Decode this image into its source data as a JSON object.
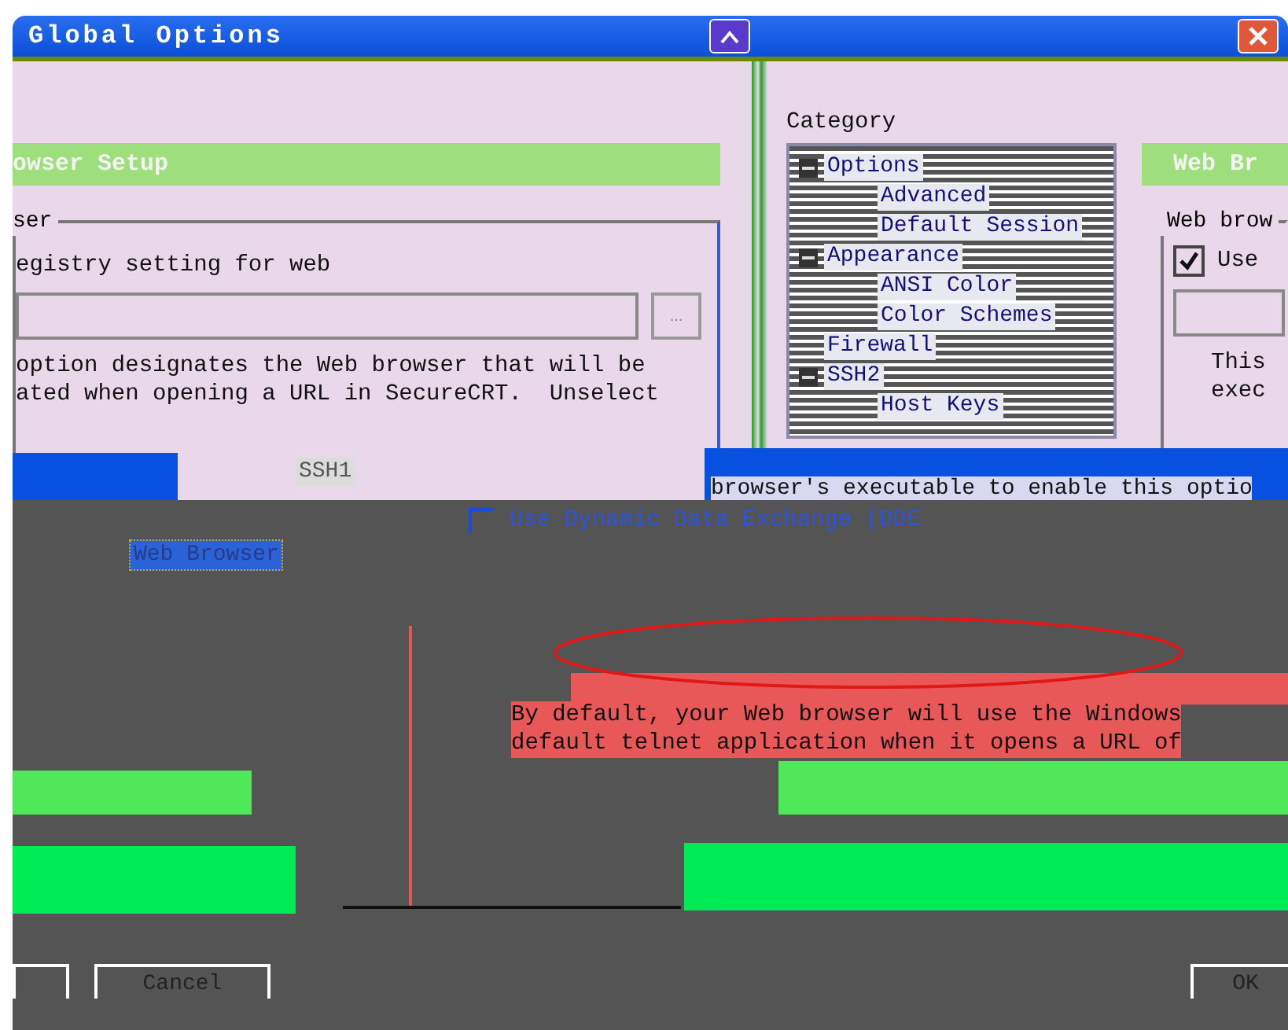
{
  "window": {
    "title": "Global Options"
  },
  "left_panel": {
    "header": "owser Setup",
    "group_label": "ser",
    "option_text": "egistry setting for web",
    "browse_button": "...",
    "description": [
      "option designates the Web browser that will be",
      "ated when opening a URL in SecureCRT.  Unselect"
    ]
  },
  "category": {
    "label": "Category",
    "items": [
      {
        "label": "Options",
        "expanded": true,
        "children": [
          {
            "label": "Advanced"
          },
          {
            "label": "Default Session"
          }
        ]
      },
      {
        "label": "Appearance",
        "expanded": true,
        "children": [
          {
            "label": "ANSI Color"
          },
          {
            "label": "Color Schemes"
          }
        ]
      },
      {
        "label": "Firewall"
      },
      {
        "label": "SSH2",
        "expanded": true,
        "children": [
          {
            "label": "Host Keys"
          }
        ]
      }
    ]
  },
  "tree_fragment": [
    {
      "label": "SSH1",
      "selected": false
    },
    {
      "label": "Web Browser",
      "selected": true
    }
  ],
  "right_panel": {
    "header": "Web Br",
    "group_label": "Web brow",
    "use_checkbox": {
      "label": "Use",
      "checked": true
    },
    "description": [
      "This",
      "exec"
    ]
  },
  "banner": {
    "text": "browser's executable to enable this optio"
  },
  "dde_checkbox": {
    "label": "Use Dynamic Data Exchange (DDE",
    "checked": false
  },
  "default_note": [
    "By default, your Web browser will use the Windows",
    "default telnet application when it opens a URL of"
  ],
  "buttons": [
    {
      "label": "Cancel"
    },
    {
      "label": "OK"
    }
  ]
}
